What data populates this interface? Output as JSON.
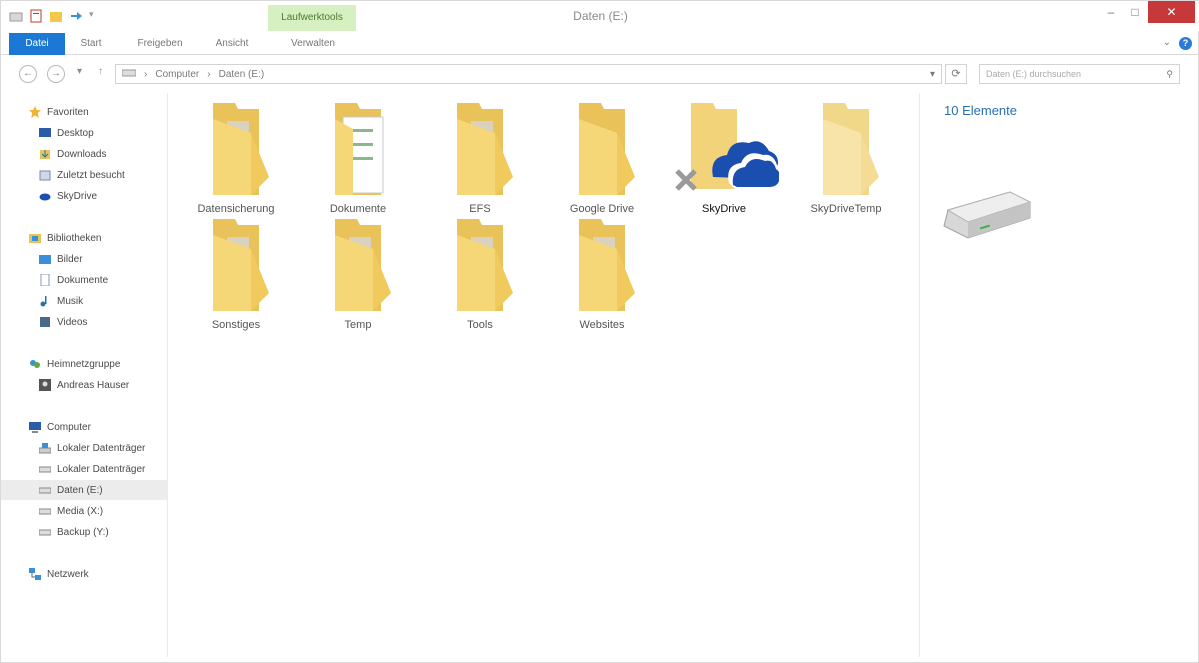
{
  "window": {
    "title": "Daten (E:)",
    "contextual_tab": "Laufwerktools",
    "minimize": "–",
    "maximize": "□",
    "close": "✕"
  },
  "ribbon": {
    "tabs": [
      "Datei",
      "Start",
      "Freigeben",
      "Ansicht",
      "Verwalten"
    ]
  },
  "address": {
    "breadcrumb": [
      "Computer",
      "Daten (E:)"
    ],
    "search_placeholder": "Daten (E:) durchsuchen"
  },
  "nav": {
    "favorites": {
      "header": "Favoriten",
      "items": [
        "Desktop",
        "Downloads",
        "Zuletzt besucht",
        "SkyDrive"
      ]
    },
    "libraries": {
      "header": "Bibliotheken",
      "items": [
        "Bilder",
        "Dokumente",
        "Musik",
        "Videos"
      ]
    },
    "homegroup": {
      "header": "Heimnetzgruppe",
      "items": [
        "Andreas Hauser"
      ]
    },
    "computer": {
      "header": "Computer",
      "items": [
        "Lokaler Datenträger",
        "Lokaler Datenträger",
        "Daten (E:)",
        "Media (X:)",
        "Backup (Y:)"
      ]
    },
    "network": {
      "header": "Netzwerk"
    }
  },
  "folders": [
    {
      "name": "Datensicherung"
    },
    {
      "name": "Dokumente"
    },
    {
      "name": "EFS"
    },
    {
      "name": "Google Drive"
    },
    {
      "name": "SkyDrive"
    },
    {
      "name": "SkyDriveTemp"
    },
    {
      "name": "Sonstiges"
    },
    {
      "name": "Temp"
    },
    {
      "name": "Tools"
    },
    {
      "name": "Websites"
    }
  ],
  "details": {
    "count": "10 Elemente"
  },
  "colors": {
    "file_tab": "#1b78d4",
    "close_button": "#c7383a",
    "contextual_tab": "#d6f0c2",
    "skydrive_blue": "#1a4fb0",
    "folder": "#f5d778"
  }
}
